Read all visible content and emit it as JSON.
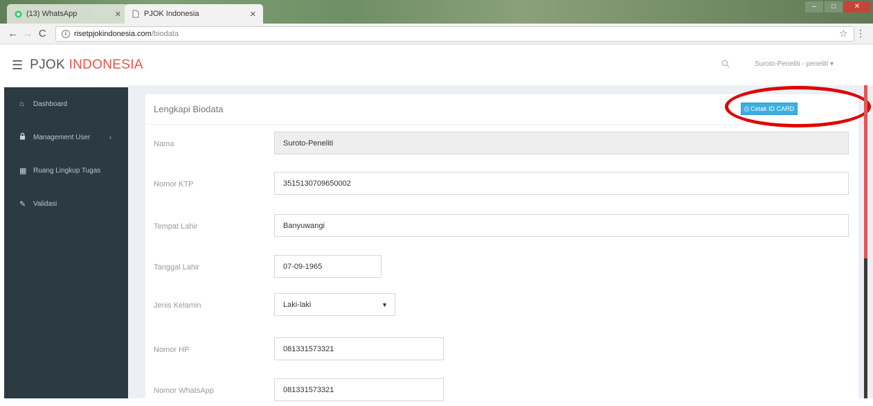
{
  "browser": {
    "tabs": [
      {
        "title": "(13) WhatsApp",
        "icon": "whatsapp-icon",
        "active": false
      },
      {
        "title": "PJOK Indonesia",
        "icon": "page-icon",
        "active": true
      }
    ],
    "url_host": "risetpjokindonesia.com",
    "url_path": "/biodata"
  },
  "header": {
    "brand_part1": "PJOK",
    "brand_part2": "INDONESIA",
    "user_menu": "Suroto-Peneliti - peneliti"
  },
  "sidebar": {
    "items": [
      {
        "label": "Dashboard",
        "icon": "home-icon"
      },
      {
        "label": "Management User",
        "icon": "lock-icon",
        "has_caret": true
      },
      {
        "label": "Ruang Lingkup Tugas",
        "icon": "table-icon"
      },
      {
        "label": "Validasi",
        "icon": "edit-icon"
      }
    ]
  },
  "panel": {
    "title": "Lengkapi Biodata",
    "action_button": "Cetak ID CARD"
  },
  "form": {
    "fields": [
      {
        "label": "Nama",
        "value": "Suroto-Peneliti",
        "readonly": true
      },
      {
        "label": "Nomor KTP",
        "value": "3515130709650002"
      },
      {
        "label": "Tempat Lahir",
        "value": "Banyuwangi"
      },
      {
        "label": "Tanggal Lahir",
        "value": "07-09-1965"
      },
      {
        "label": "Jenis Kelamin",
        "value": "Laki-laki",
        "type": "select"
      },
      {
        "label": "Nomor HP",
        "value": "081331573321"
      },
      {
        "label": "Nomor WhatsApp",
        "value": "081331573321"
      }
    ]
  },
  "colors": {
    "brand_accent": "#e8534a",
    "sidebar_bg": "#2c3b41",
    "button_info": "#3caee0",
    "annotation_circle": "#e10000"
  }
}
